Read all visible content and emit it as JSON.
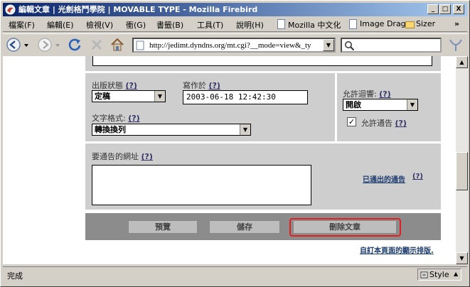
{
  "window": {
    "title": "編輯文章 | 光劍格鬥學院 | MOVABLE TYPE - Mozilla Firebird",
    "minimize_glyph": "_",
    "maximize_glyph": "□",
    "close_glyph": "X"
  },
  "menu": {
    "items": [
      "檔案(F)",
      "編輯(E)",
      "檢視(V)",
      "衝(G)",
      "書籤(B)",
      "工具(T)",
      "說明(H)"
    ],
    "bookmarks": [
      "Mozilla 中文化",
      "Image Drag",
      "Sizer"
    ],
    "overflow": "»"
  },
  "nav": {
    "url": "http://jedimt.dyndns.org/mt.cgi?__mode=view&_ty",
    "search_value": ""
  },
  "form": {
    "status_label": "出版狀態",
    "status_help": "(?)",
    "status_value": "定稿",
    "written_label": "寫作於",
    "written_help": "(?)",
    "written_value": "2003-06-18 12:42:30",
    "comments_label": "允許迴響:",
    "comments_help": "(?)",
    "comments_value": "開啟",
    "format_label": "文字格式:",
    "format_help": "(?)",
    "format_value": "轉換換列",
    "allow_ping_label": "允許通告",
    "allow_ping_help": "(?)",
    "allow_ping_checked": true,
    "ping_urls_label": "要通告的網址",
    "ping_urls_help": "(?)",
    "ping_urls_value": "",
    "pinged_link": "已通出的通告",
    "pinged_help": "(?)"
  },
  "actions": {
    "preview": "預覽",
    "save": "儲存",
    "delete": "刪除文章"
  },
  "customize_link": "自訂本頁面的顯示排版.",
  "status": {
    "text": "完成",
    "style_label": "Style"
  },
  "colors": {
    "highlight": "#e02020",
    "titlebar_start": "#0a246a",
    "panel": "#cecece"
  }
}
